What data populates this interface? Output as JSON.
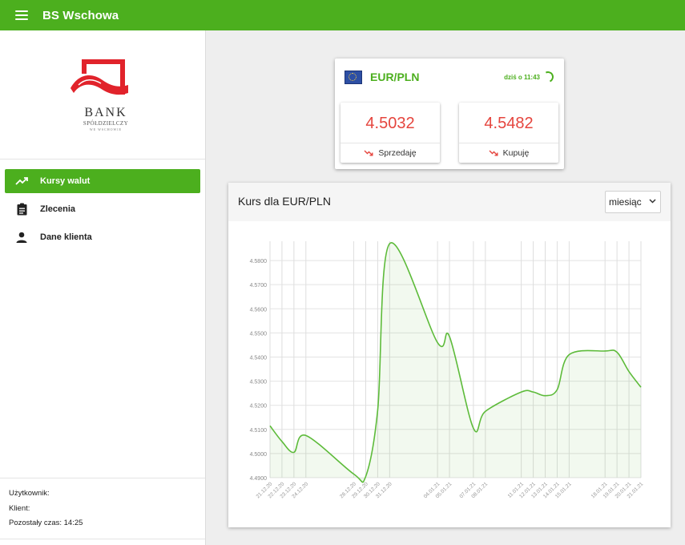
{
  "app": {
    "title": "BS Wschowa"
  },
  "logo": {
    "bank": "BANK",
    "line1": "SPÓŁDZIELCZY",
    "line2": "WE WSCHOWIE"
  },
  "nav": [
    {
      "label": "Kursy walut",
      "icon": "trending-up-icon",
      "active": true
    },
    {
      "label": "Zlecenia",
      "icon": "clipboard-icon",
      "active": false
    },
    {
      "label": "Dane klienta",
      "icon": "person-icon",
      "active": false
    }
  ],
  "footer": {
    "user": "Użytkownik:",
    "client": "Klient:",
    "time": "Pozostały czas: 14:25"
  },
  "rate": {
    "pair": "EUR/PLN",
    "updated": "dziś o 11:43",
    "sell": {
      "value": "4.5032",
      "label": "Sprzedaję"
    },
    "buy": {
      "value": "4.5482",
      "label": "Kupuję"
    }
  },
  "chart_section": {
    "title": "Kurs dla EUR/PLN",
    "period": "miesiąc"
  },
  "colors": {
    "accent": "#4caf1e",
    "rate_value": "#e5453e",
    "trend_down": "#e5453e"
  },
  "chart_data": {
    "type": "area",
    "title": "",
    "xlabel": "",
    "ylabel": "",
    "grid": true,
    "ylim": [
      4.49,
      4.588
    ],
    "yticks": [
      "4.4900",
      "4.5000",
      "4.5100",
      "4.5200",
      "4.5300",
      "4.5400",
      "4.5500",
      "4.5600",
      "4.5700",
      "4.5800"
    ],
    "x": [
      "21.12.20",
      "22.12.20",
      "23.12.20",
      "24.12.20",
      "28.12.20",
      "29.12.20",
      "30.12.20",
      "31.12.20",
      "04.01.21",
      "05.01.21",
      "07.01.21",
      "08.01.21",
      "11.01.21",
      "12.01.21",
      "13.01.21",
      "14.01.21",
      "15.01.21",
      "18.01.21",
      "19.01.21",
      "20.01.21",
      "21.01.21"
    ],
    "values": [
      4.5115,
      4.505,
      4.5005,
      4.5075,
      4.4915,
      4.4905,
      4.518,
      4.587,
      4.546,
      4.5485,
      4.5105,
      4.5175,
      4.5255,
      4.5255,
      4.524,
      4.5265,
      4.541,
      4.5425,
      4.542,
      4.534,
      4.5275
    ]
  }
}
